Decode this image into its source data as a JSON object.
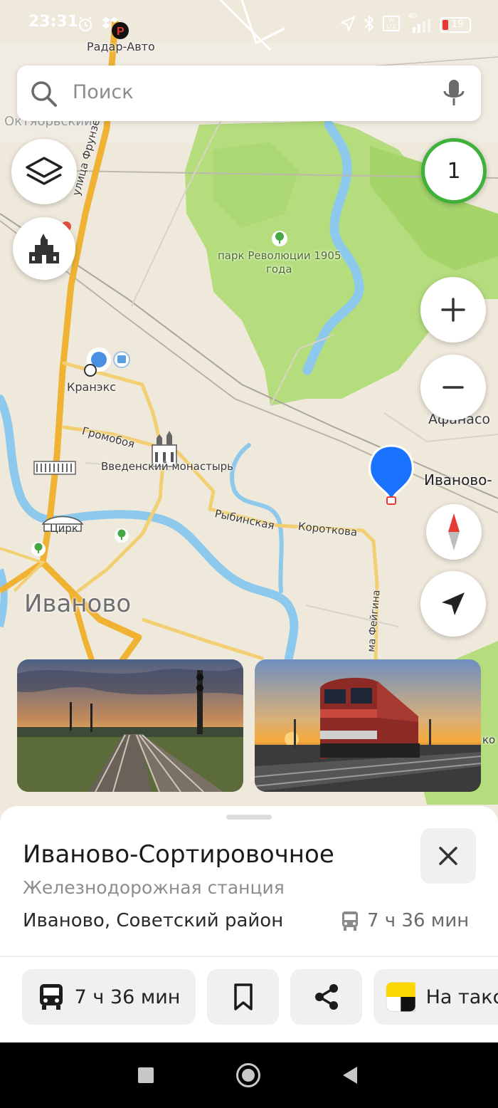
{
  "status_bar": {
    "time": "23:31",
    "battery": "19",
    "network": "4G",
    "lte": "LTE",
    "icons": [
      "alarm-icon",
      "dropbox-icon",
      "parking-app-icon",
      "location-arrow-icon",
      "bluetooth-icon",
      "volte-icon",
      "signal-icon",
      "battery-icon"
    ]
  },
  "search": {
    "placeholder": "Поиск",
    "icons": [
      "search-icon",
      "microphone-icon"
    ]
  },
  "map": {
    "labels": {
      "radar_auto": "Радар-Авто",
      "oktyabrsky": "Октябрьский",
      "frunze": "улица Фрунзе",
      "park_line1": "парк Революции 1905",
      "park_line2": "года",
      "kraneks": "Кранэкс",
      "gromoboya": "Громобоя",
      "vvedensky": "Введенский монастырь",
      "tsirk": "Цирк",
      "rybinskaya": "Рыбинская",
      "korotkova": "Короткова",
      "feyna": "ма Фейгина",
      "city": "Иваново",
      "afanasovo": "Афанасо",
      "ivanovo_station": "Иваново-",
      "edge_ko": "ко"
    },
    "traffic_level": "1",
    "colors": {
      "land": "#efe9dc",
      "park": "#a9d96b",
      "water": "#8cc9ec",
      "road": "#efb233",
      "pin": "#1a73ff"
    }
  },
  "controls": {
    "layers": "layers-icon",
    "places": "building-icon",
    "zoom_in": "plus-icon",
    "zoom_out": "minus-icon",
    "compass": "compass-icon",
    "my_location": "navigation-arrow-icon"
  },
  "photos": [
    {
      "name": "railway-tracks-sunset-photo"
    },
    {
      "name": "locomotive-sunset-photo"
    }
  ],
  "place": {
    "title": "Иваново-Сортировочное",
    "category": "Железнодорожная станция",
    "address": "Иваново, Советский район",
    "travel_time": "7 ч 36 мин"
  },
  "actions": {
    "route_label": "7 ч 36 мин",
    "taxi_label": "На такси"
  },
  "nav_bar": {
    "icons": [
      "recent-apps-icon",
      "home-icon",
      "back-icon"
    ]
  }
}
